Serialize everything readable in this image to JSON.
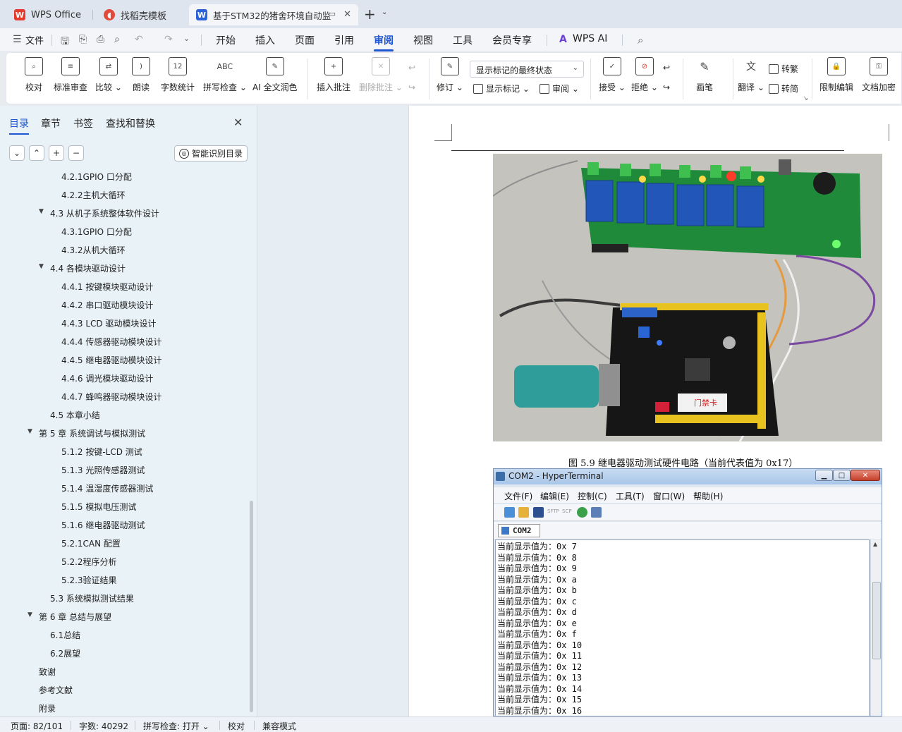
{
  "tabs": [
    {
      "label": "WPS Office",
      "icon": "wps-logo-icon"
    },
    {
      "label": "找稻壳模板",
      "icon": "docer-logo-icon"
    },
    {
      "label": "基于STM32的猪舍环境自动监",
      "icon": "word-doc-icon",
      "active": true
    }
  ],
  "menu": {
    "file": "文件",
    "items": [
      "开始",
      "插入",
      "页面",
      "引用",
      "审阅",
      "视图",
      "工具",
      "会员专享"
    ],
    "active": "审阅",
    "ai": "WPS AI"
  },
  "ribbon": {
    "proofread": "校对",
    "standard_review": "标准审查",
    "compare": "比较",
    "read_aloud": "朗读",
    "word_count": "字数统计",
    "spell_check": "拼写检查",
    "ai_proofread": "AI 全文润色",
    "insert_comment": "插入批注",
    "delete_comment": "删除批注",
    "track_changes": "修订",
    "markup_mode": "显示标记的最终状态",
    "show_markup": "显示标记",
    "review_pane": "审阅",
    "accept": "接受",
    "reject": "拒绝",
    "ink": "画笔",
    "translate": "翻译",
    "to_traditional": "转繁",
    "to_simplified": "转简",
    "restrict_editing": "限制编辑",
    "encrypt_doc": "文档加密",
    "icon_count_text": "12",
    "icon_abc_text": "ABC"
  },
  "nav": {
    "tabs": [
      "目录",
      "章节",
      "书签",
      "查找和替换"
    ],
    "active_tab": "目录",
    "smart_toc": "智能识别目录",
    "toc": [
      {
        "text": "4.2.1GPIO 口分配",
        "level": 3
      },
      {
        "text": "4.2.2主机大循环",
        "level": 3
      },
      {
        "text": "4.3  从机子系统整体软件设计",
        "level": 2,
        "expanded": true
      },
      {
        "text": "4.3.1GPIO 口分配",
        "level": 3
      },
      {
        "text": "4.3.2从机大循环",
        "level": 3
      },
      {
        "text": "4.4  各模块驱动设计",
        "level": 2,
        "expanded": true
      },
      {
        "text": "4.4.1 按键模块驱动设计",
        "level": 3
      },
      {
        "text": "4.4.2 串口驱动模块设计",
        "level": 3
      },
      {
        "text": "4.4.3 LCD 驱动模块设计",
        "level": 3
      },
      {
        "text": "4.4.4 传感器驱动模块设计",
        "level": 3
      },
      {
        "text": "4.4.5 继电器驱动模块设计",
        "level": 3
      },
      {
        "text": "4.4.6 调光模块驱动设计",
        "level": 3
      },
      {
        "text": "4.4.7 蜂鸣器驱动模块设计",
        "level": 3
      },
      {
        "text": "4.5  本章小结",
        "level": 2
      },
      {
        "text": "第 5 章  系统调试与模拟测试",
        "level": 1,
        "expanded": true
      },
      {
        "text": "5.1.2 按键-LCD 测试",
        "level": 3
      },
      {
        "text": "5.1.3 光照传感器测试",
        "level": 3
      },
      {
        "text": "5.1.4 温湿度传感器测试",
        "level": 3
      },
      {
        "text": "5.1.5 模拟电压测试",
        "level": 3
      },
      {
        "text": "5.1.6 继电器驱动测试",
        "level": 3
      },
      {
        "text": "5.2.1CAN 配置",
        "level": 3
      },
      {
        "text": "5.2.2程序分析",
        "level": 3
      },
      {
        "text": "5.2.3验证结果",
        "level": 3
      },
      {
        "text": "5.3  系统模拟测试结果",
        "level": 2
      },
      {
        "text": "第 6 章  总结与展望",
        "level": 1,
        "expanded": true
      },
      {
        "text": "6.1总结",
        "level": 2
      },
      {
        "text": "6.2展望",
        "level": 2
      },
      {
        "text": "致谢",
        "level": 1
      },
      {
        "text": "参考文献",
        "level": 1
      },
      {
        "text": "附录",
        "level": 1
      }
    ]
  },
  "document": {
    "figure_caption": "图 5.9  继电器驱动测试硬件电路（当前代表值为 0x17）",
    "photo_label": "门禁卡",
    "hyperterminal": {
      "title": "COM2 - HyperTerminal",
      "menu": [
        "文件(F)",
        "编辑(E)",
        "控制(C)",
        "工具(T)",
        "窗口(W)",
        "帮助(H)"
      ],
      "tab": "COM2",
      "toolbar_text": [
        "SFTP",
        "SCP"
      ],
      "prefix": "当前显示值为：",
      "values": [
        "0x 7",
        "0x 8",
        "0x 9",
        "0x a",
        "0x b",
        "0x c",
        "0x d",
        "0x e",
        "0x f",
        "0x 10",
        "0x 11",
        "0x 12",
        "0x 13",
        "0x 14",
        "0x 15",
        "0x 16"
      ]
    }
  },
  "status": {
    "page": "页面: 82/101",
    "words": "字数: 40292",
    "spell": "拼写检查: 打开",
    "proof": "校对",
    "compat": "兼容模式"
  },
  "colors": {
    "accent": "#1f56d1",
    "nav_bg": "#e8f2f7",
    "pcb_green": "#1f8a3a",
    "relay_blue": "#2256b8"
  }
}
